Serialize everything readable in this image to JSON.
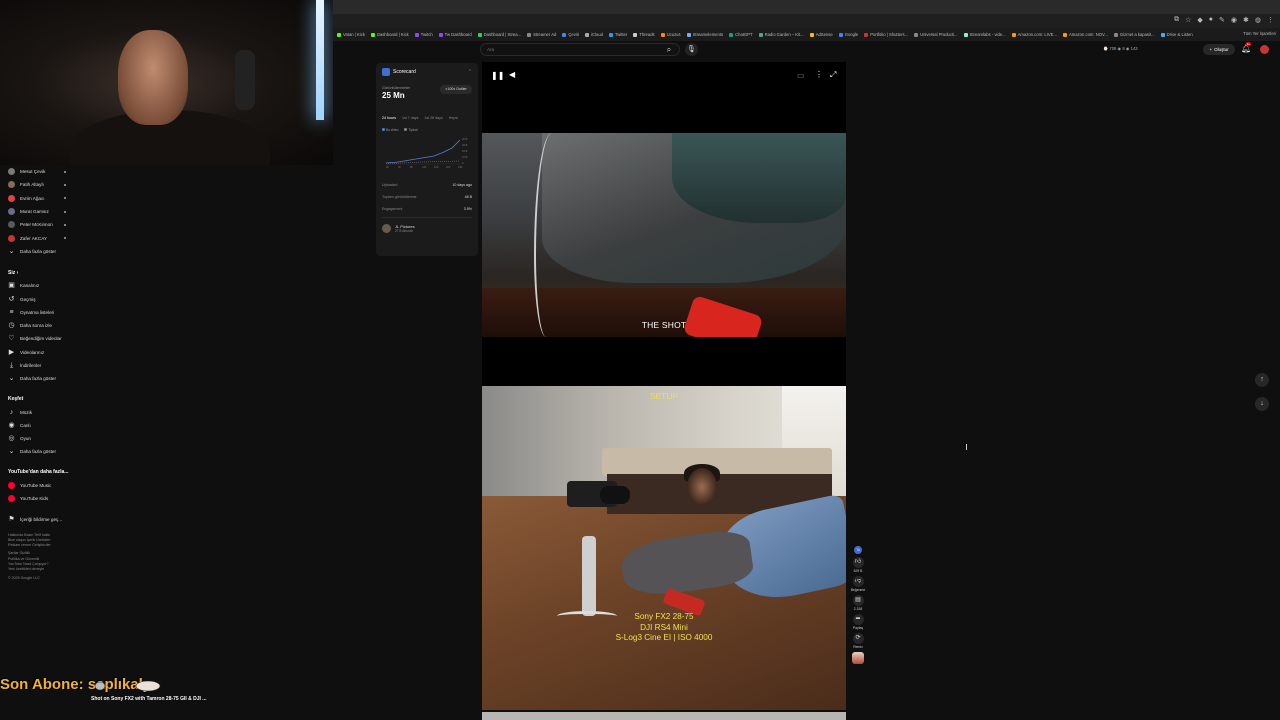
{
  "bookmarks": [
    {
      "label": "Vatan | Kick",
      "color": "#53fc18"
    },
    {
      "label": "Dashboard | Kick",
      "color": "#53fc18"
    },
    {
      "label": "Twitch",
      "color": "#9146ff"
    },
    {
      "label": "Tw Dashboard",
      "color": "#9146ff"
    },
    {
      "label": "Dashboard | Strea...",
      "color": "#2ecc71"
    },
    {
      "label": "Streamer Ad",
      "color": "#888888"
    },
    {
      "label": "Çeviri",
      "color": "#4285f4"
    },
    {
      "label": "iCloud",
      "color": "#aaaaaa"
    },
    {
      "label": "Twitter",
      "color": "#1da1f2"
    },
    {
      "label": "Threads",
      "color": "#cccccc"
    },
    {
      "label": "Ucuzus",
      "color": "#ff8800"
    },
    {
      "label": "Streamelements",
      "color": "#77aaff"
    },
    {
      "label": "ChatGPT",
      "color": "#10a37f"
    },
    {
      "label": "Radio Garden – Kit...",
      "color": "#44aa88"
    },
    {
      "label": "AdSense",
      "color": "#fbbc04"
    },
    {
      "label": "Google",
      "color": "#4285f4"
    },
    {
      "label": "Portfolio | Shutters...",
      "color": "#cc3333"
    },
    {
      "label": "Universal Producti...",
      "color": "#888888"
    },
    {
      "label": "Streamlabs - vide...",
      "color": "#80f5d2"
    },
    {
      "label": "Amazon.com: LIVE...",
      "color": "#ff9900"
    },
    {
      "label": "Amazon.com: NOV...",
      "color": "#ff9900"
    },
    {
      "label": "Gizmet a kapasit...",
      "color": "#888888"
    },
    {
      "label": "Drive & Listen",
      "color": "#44aaff"
    }
  ],
  "bookmarks_all": "Tüm Yer İşaretleri",
  "search": {
    "placeholder": "Ara"
  },
  "top_stats": "⌚ 708  ◉ 8  ◉ 143",
  "create_label": "Oluştur",
  "bell_badge": "9+",
  "sidebar": {
    "subscriptions": [
      {
        "name": "Mesut Çevik",
        "color": "#7a7a7a"
      },
      {
        "name": "Fatih Altaylı",
        "color": "#8a6a5a"
      },
      {
        "name": "Evrim Ağacı",
        "color": "#d44"
      },
      {
        "name": "Murat Gamsız",
        "color": "#6a6a8a"
      },
      {
        "name": "Peter McKinnon",
        "color": "#5a5a5a"
      },
      {
        "name": "Zafer AKCAY",
        "color": "#c33"
      }
    ],
    "show_more": "Daha fazla göster",
    "you_heading": "Siz",
    "you_items": [
      {
        "label": "Kanalınız",
        "icon": "▣"
      },
      {
        "label": "Geçmiş",
        "icon": "↺"
      },
      {
        "label": "Oynatma listeleri",
        "icon": "≡"
      },
      {
        "label": "Daha sonra izle",
        "icon": "◷"
      },
      {
        "label": "Beğendiğim videolar",
        "icon": "♡"
      },
      {
        "label": "Videolarınız",
        "icon": "▶"
      },
      {
        "label": "İndirilenler",
        "icon": "⤓"
      },
      {
        "label": "Daha fazla göster",
        "icon": "⌄"
      }
    ],
    "explore_heading": "Keşfet",
    "explore_items": [
      {
        "label": "Müzik",
        "icon": "♪"
      },
      {
        "label": "Canlı",
        "icon": "◉"
      },
      {
        "label": "Oyun",
        "icon": "◎"
      },
      {
        "label": "Daha fazla göster",
        "icon": "⌄"
      }
    ],
    "more_heading": "YouTube'dan daha fazla...",
    "more_items": [
      {
        "label": "YouTube Music",
        "color": "#ff0033"
      },
      {
        "label": "YouTube Kids",
        "color": "#ff0033"
      }
    ],
    "report": "İçeriği bildirme geç...",
    "footer": [
      "Hakkında   Basın   Telif hakkı",
      "Bize ulaşın   İçerik Üreticiler",
      "Reklam verme   Geliştiriciler",
      "",
      "Şartlar   Gizlilik",
      "Politika ve Güvenlik",
      "YouTube Nasıl Çalışıyor?",
      "Yeni özellikleri deneyin",
      "",
      "© 2025 Google LLC"
    ]
  },
  "scorecard": {
    "title": "Scorecard",
    "views_label": "Görüntülenmeler",
    "views_value": "25 Mn",
    "badge": "×100x Outlier",
    "tabs": [
      "24 hours",
      "1st 7 days",
      "1st 28 days",
      "Hepsi"
    ],
    "legend": [
      {
        "label": "Bu video",
        "color": "#5b7bd8"
      },
      {
        "label": "Tipical",
        "color": "#888888"
      }
    ],
    "chart_ticks_x": [
      "0h",
      "4h",
      "8h",
      "12h",
      "16h",
      "20h",
      "24h"
    ],
    "chart_ticks_y": [
      "40 B",
      "30 B",
      "20 B",
      "10 B",
      "0"
    ],
    "rows": [
      {
        "label": "Uploaded",
        "value": "10 days ago"
      },
      {
        "label": "Toplam görüntülenme",
        "value": "48 B"
      },
      {
        "label": "Engagement",
        "value": "3.5%"
      }
    ],
    "channel": {
      "name": "JL Pictures",
      "subs": "27 B Abonelı"
    }
  },
  "player": {
    "shot_label": "THE SHOT",
    "setup_label": "SETUP",
    "specs": [
      "Sony FX2 28-75",
      "DJI RS4 Mini",
      "S-Log3 Cine EI | ISO 4000"
    ]
  },
  "actions": {
    "pill": "Ta",
    "like": "629 B",
    "dislike": "Beğenme",
    "comments": "2.318",
    "share": "Paylaş",
    "remix": "Remix"
  },
  "overlay": {
    "sub_alert": "Son Abone: saplıkaly",
    "caption": "Shot on Sony FX2 with Tamron 28-75 GII & DJI ..."
  }
}
